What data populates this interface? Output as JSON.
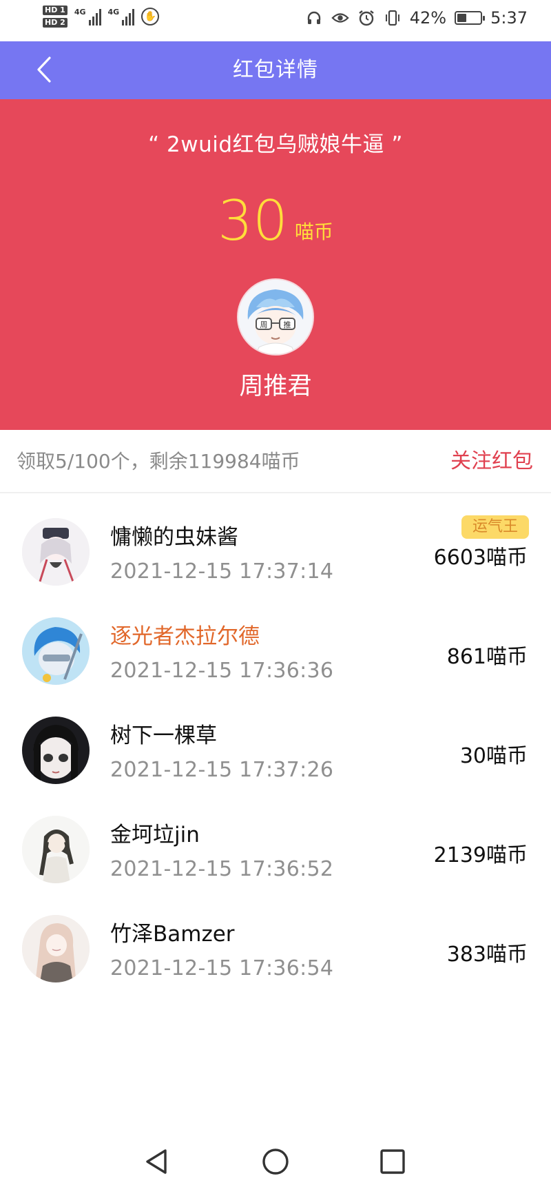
{
  "status_bar": {
    "hd1": "HD 1",
    "hd2": "HD 2",
    "net1": "4G",
    "net2": "4G",
    "battery_percent": "42%",
    "battery_level": 0.42,
    "time": "5:37",
    "icons": [
      "headphones-icon",
      "eye-icon",
      "alarm-icon",
      "vibrate-icon",
      "battery-icon",
      "leaf-icon"
    ]
  },
  "header": {
    "title": "红包详情"
  },
  "packet": {
    "message": "“ 2wuid红包乌贼娘牛逼 ”",
    "amount": "30",
    "unit": "喵币",
    "sender_name": "周推君",
    "sender_avatar_text": [
      "周",
      "推"
    ]
  },
  "summary": {
    "text": "领取5/100个，剩余119984喵币",
    "follow_label": "关注红包"
  },
  "recipients": [
    {
      "name": "慵懒的虫妹酱",
      "time": "2021-12-15 17:37:14",
      "coins": "6603喵币",
      "badge": "运气王"
    },
    {
      "name": "逐光者杰拉尔德",
      "time": "2021-12-15 17:36:36",
      "coins": "861喵币"
    },
    {
      "name": "树下一棵草",
      "time": "2021-12-15 17:37:26",
      "coins": "30喵币"
    },
    {
      "name": "金坷垃jin",
      "time": "2021-12-15 17:36:52",
      "coins": "2139喵币"
    },
    {
      "name": "竹泽Bamzer",
      "time": "2021-12-15 17:36:54",
      "coins": "383喵币"
    }
  ],
  "colors": {
    "header": "#7676f2",
    "hero": "#e6485a",
    "amount": "#ffde3b",
    "follow": "#e0404f",
    "highlight_name": "#e1672a",
    "badge_bg": "#fcd967",
    "badge_text": "#d9892a"
  }
}
